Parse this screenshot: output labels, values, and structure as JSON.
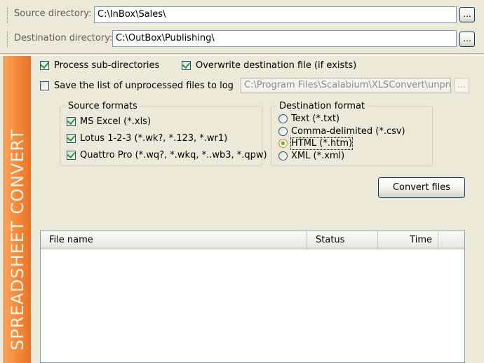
{
  "source_row": {
    "label": "Source directory:",
    "value": "C:\\InBox\\Sales\\",
    "browse_label": "..."
  },
  "destination_row": {
    "label": "Destination directory:",
    "value": "C:\\OutBox\\Publishing\\",
    "browse_label": "..."
  },
  "sidebar": {
    "text": "SPREADSHEET CONVERT",
    "color": "#f6893a"
  },
  "options": {
    "process_subdirs": {
      "label": "Process sub-directories",
      "checked": true
    },
    "overwrite": {
      "label": "Overwrite destination file (if exists)",
      "checked": true
    },
    "save_log": {
      "label": "Save the list of unprocessed files to log",
      "checked": false
    },
    "log_path": "C:\\Program Files\\Scalabium\\XLSConvert\\unproc",
    "log_browse_label": "..."
  },
  "source_formats": {
    "title": "Source formats",
    "items": [
      {
        "label": "MS Excel (*.xls)",
        "checked": true
      },
      {
        "label": "Lotus 1-2-3 (*.wk?, *.123, *.wr1)",
        "checked": true
      },
      {
        "label": "Quattro Pro (*.wq?, *.wkq, *..wb3, *.qpw)",
        "checked": true
      }
    ]
  },
  "destination_format": {
    "title": "Destination format",
    "items": [
      {
        "label": "Text (*.txt)",
        "selected": false
      },
      {
        "label": "Comma-delimited (*.csv)",
        "selected": false
      },
      {
        "label": "HTML (*.htm)",
        "selected": true
      },
      {
        "label": "XML (*.xml)",
        "selected": false
      }
    ]
  },
  "convert_button": {
    "label": "Convert files"
  },
  "file_list": {
    "columns": [
      "File name",
      "Status",
      "Time"
    ],
    "rows": []
  }
}
